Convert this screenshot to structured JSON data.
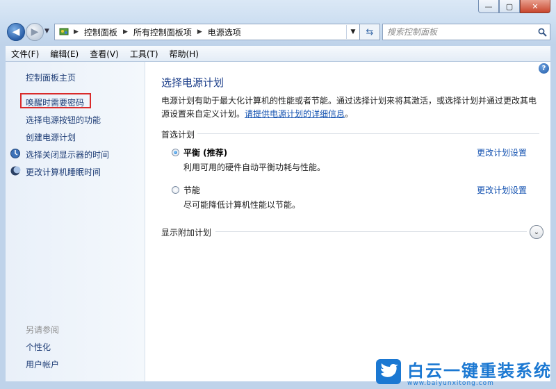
{
  "window": {
    "minimize_glyph": "—",
    "maximize_glyph": "▢",
    "close_glyph": "✕"
  },
  "address": {
    "breadcrumbs": [
      "控制面板",
      "所有控制面板项",
      "电源选项"
    ]
  },
  "search": {
    "placeholder": "搜索控制面板"
  },
  "menu": [
    "文件(F)",
    "编辑(E)",
    "查看(V)",
    "工具(T)",
    "帮助(H)"
  ],
  "sidebar": {
    "home": "控制面板主页",
    "items": [
      {
        "label": "唤醒时需要密码"
      },
      {
        "label": "选择电源按钮的功能"
      },
      {
        "label": "创建电源计划"
      },
      {
        "label": "选择关闭显示器的时间",
        "icon": "display-icon"
      },
      {
        "label": "更改计算机睡眠时间",
        "icon": "moon-icon"
      }
    ],
    "see_also_title": "另请参阅",
    "see_also": [
      "个性化",
      "用户帐户"
    ]
  },
  "main": {
    "title": "选择电源计划",
    "description": "电源计划有助于最大化计算机的性能或者节能。通过选择计划来将其激活，或选择计划并通过更改其电源设置来自定义计划。",
    "info_link": "请提供电源计划的详细信息",
    "description_end": "。",
    "preferred_heading": "首选计划",
    "plans": [
      {
        "name": "平衡 (推荐)",
        "description": "利用可用的硬件自动平衡功耗与性能。",
        "selected": true,
        "change_link": "更改计划设置"
      },
      {
        "name": "节能",
        "description": "尽可能降低计算机性能以节能。",
        "selected": false,
        "change_link": "更改计划设置"
      }
    ],
    "extra_heading": "显示附加计划"
  },
  "watermark": {
    "title": "白云一键重装系统",
    "url": "www.baiyunxitong.com"
  },
  "colors": {
    "link": "#1553b1",
    "title": "#1d3f8a",
    "highlight_box": "#d92b2b",
    "watermark": "#1b78d2"
  }
}
